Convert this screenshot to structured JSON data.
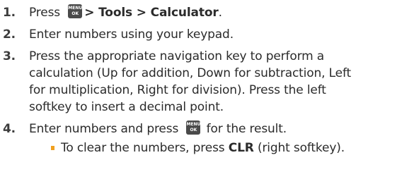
{
  "steps": [
    {
      "number": "1.",
      "parts": {
        "pre": "Press",
        "key_top": "MENU",
        "key_bottom": "OK",
        "path": "> Tools > Calculator",
        "end": "."
      }
    },
    {
      "number": "2.",
      "text": "Enter numbers using your keypad."
    },
    {
      "number": "3.",
      "lines": [
        "Press the appropriate navigation key to perform a",
        "calculation (Up for addition, Down for subtraction, Left",
        "for multiplication, Right for division). Press the left",
        "softkey to insert a decimal point."
      ]
    },
    {
      "number": "4.",
      "parts": {
        "pre": "Enter numbers and press",
        "key_top": "MENU",
        "key_bottom": "OK",
        "post": "for the result."
      },
      "bullet": {
        "pre": "To clear the numbers, press",
        "bold": "CLR",
        "post": "(right softkey)."
      }
    }
  ],
  "colors": {
    "text": "#2b2b2b",
    "key_background": "#4a4a4a",
    "bullet": "#f0a020"
  },
  "icons": {
    "menu_ok_key": "menu-ok-key-icon",
    "bullet": "square-bullet-icon"
  }
}
